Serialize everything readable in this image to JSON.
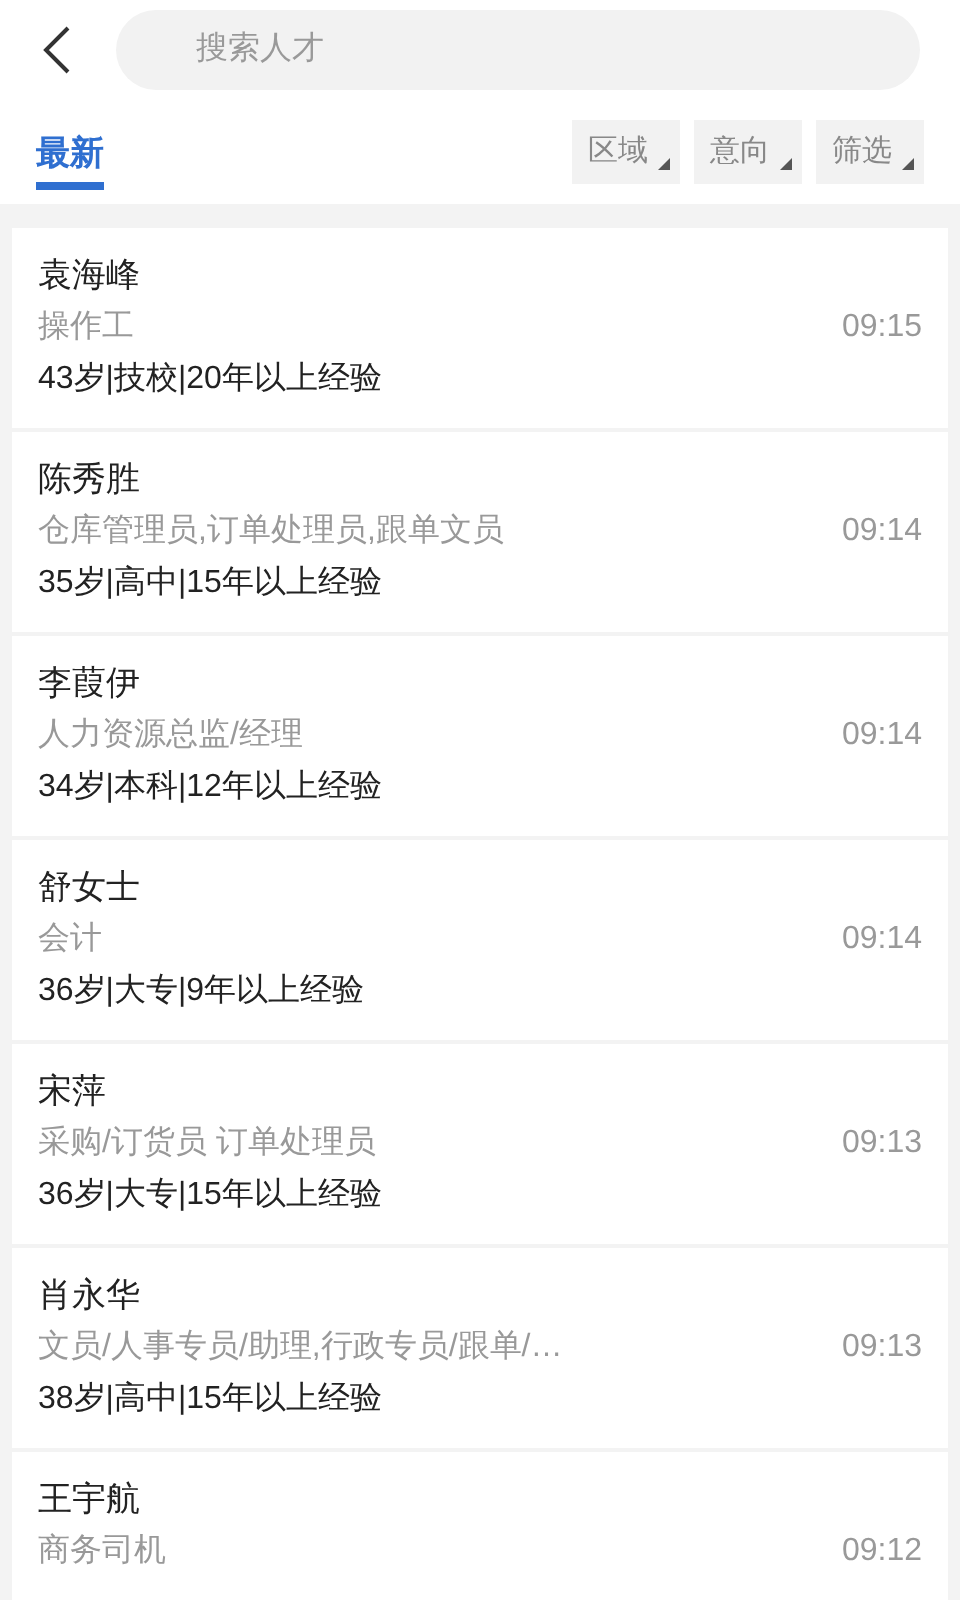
{
  "search": {
    "placeholder": "搜索人才"
  },
  "tabs": [
    {
      "label": "最新",
      "selected": true
    }
  ],
  "filters": [
    {
      "label": "区域"
    },
    {
      "label": "意向"
    },
    {
      "label": "筛选"
    }
  ],
  "candidates": [
    {
      "name": "袁海峰",
      "position": "操作工",
      "details": "43岁|技校|20年以上经验",
      "time": "09:15"
    },
    {
      "name": "陈秀胜",
      "position": "仓库管理员,订单处理员,跟单文员",
      "details": "35岁|高中|15年以上经验",
      "time": "09:14"
    },
    {
      "name": "李葭伊",
      "position": "人力资源总监/经理",
      "details": "34岁|本科|12年以上经验",
      "time": "09:14"
    },
    {
      "name": "舒女士",
      "position": "会计",
      "details": "36岁|大专|9年以上经验",
      "time": "09:14"
    },
    {
      "name": "宋萍",
      "position": "采购/订货员 订单处理员",
      "details": "36岁|大专|15年以上经验",
      "time": "09:13"
    },
    {
      "name": "肖永华",
      "position": "文员/人事专员/助理,行政专员/跟单/…",
      "details": "38岁|高中|15年以上经验",
      "time": "09:13"
    },
    {
      "name": "王宇航",
      "position": "商务司机",
      "time": "09:12"
    }
  ]
}
